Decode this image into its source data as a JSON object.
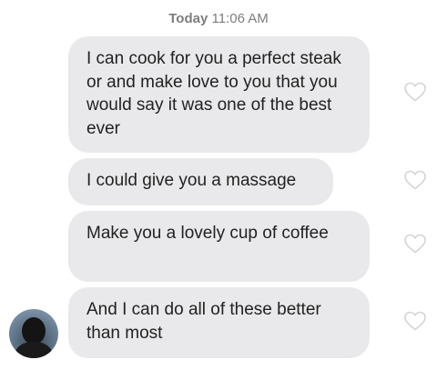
{
  "conversation": {
    "timestamp_day": "Today",
    "timestamp_time": "11:06 AM",
    "messages": [
      {
        "text": "I can cook for you a perfect steak or and make love to you that you would say it was one of the best ever",
        "liked": false
      },
      {
        "text": "I could give you a massage",
        "liked": false
      },
      {
        "text": "Make you a lovely cup of coffee",
        "liked": false
      },
      {
        "text": "And I can do all of these better than most",
        "liked": false
      }
    ]
  },
  "icons": {
    "like": "heart-outline-icon",
    "avatar": "profile-photo"
  },
  "colors": {
    "bubble": "#e9e9eb",
    "timestamp": "#7d7d7d",
    "heart_outline": "#d4d4d4"
  }
}
